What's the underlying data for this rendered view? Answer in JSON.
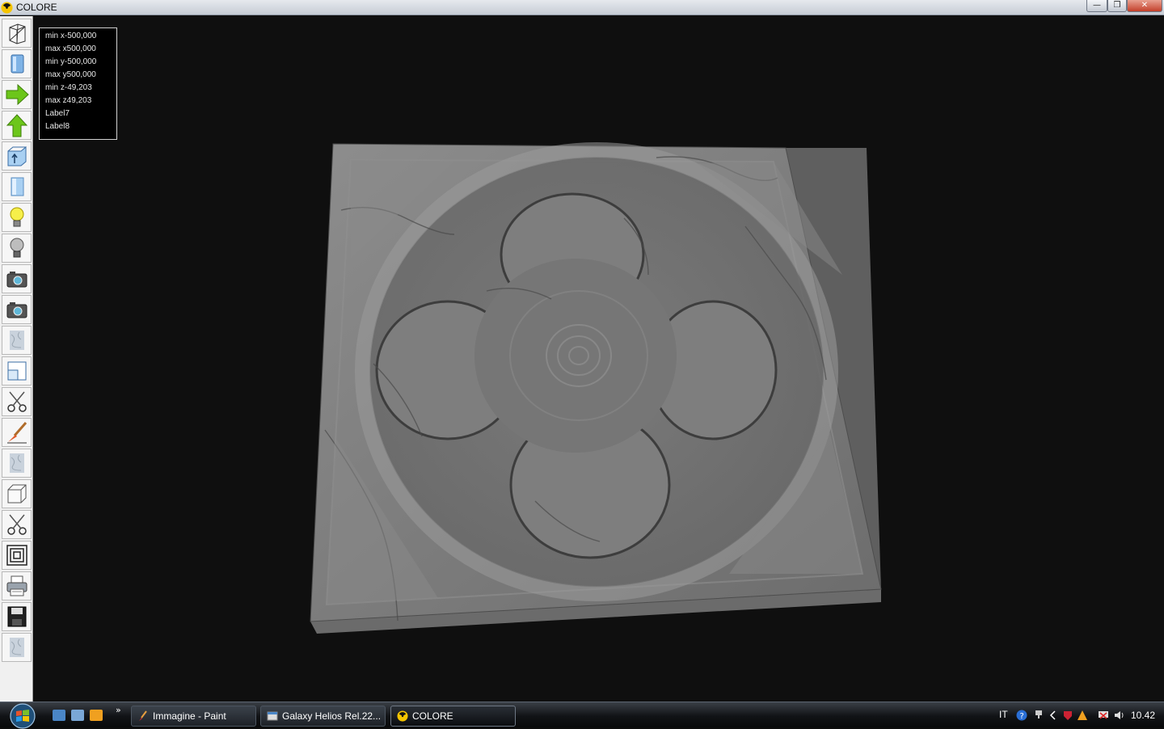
{
  "window": {
    "title": "COLORE",
    "controls": {
      "minimize": "—",
      "maximize": "❒",
      "close": "✕"
    }
  },
  "toolbar": {
    "tools": [
      {
        "name": "wireframe-tool",
        "icon": "wireframe-box-icon"
      },
      {
        "name": "solid-view-tool",
        "icon": "blue-cylinder-icon"
      },
      {
        "name": "arrow-right-tool",
        "icon": "green-arrow-right-icon"
      },
      {
        "name": "arrow-up-tool",
        "icon": "green-arrow-up-icon"
      },
      {
        "name": "extrude-tool",
        "icon": "blue-cube-arrow-icon"
      },
      {
        "name": "cylinder-tool",
        "icon": "light-blue-cylinder-icon"
      },
      {
        "name": "light-on-tool",
        "icon": "yellow-bulb-icon"
      },
      {
        "name": "light-off-tool",
        "icon": "gray-bulb-icon"
      },
      {
        "name": "camera-tool",
        "icon": "camera-icon"
      },
      {
        "name": "camera-2-tool",
        "icon": "camera-icon"
      },
      {
        "name": "texture-tool",
        "icon": "marble-texture-icon"
      },
      {
        "name": "window-tool",
        "icon": "window-square-icon"
      },
      {
        "name": "cut-tool",
        "icon": "scissors-icon"
      },
      {
        "name": "brush-tool",
        "icon": "paint-brush-icon"
      },
      {
        "name": "texture-2-tool",
        "icon": "marble-texture-icon"
      },
      {
        "name": "box-tool",
        "icon": "white-box-icon"
      },
      {
        "name": "cut-2-tool",
        "icon": "scissors-icon"
      },
      {
        "name": "frame-tool",
        "icon": "concentric-squares-icon"
      },
      {
        "name": "print-tool",
        "icon": "printer-icon"
      },
      {
        "name": "save-tool",
        "icon": "floppy-disk-icon"
      },
      {
        "name": "texture-3-tool",
        "icon": "marble-texture-icon"
      }
    ]
  },
  "info": {
    "min_x": "min x-500,000",
    "max_x": "max x500,000",
    "min_y": "min y-500,000",
    "max_y": "max y500,000",
    "min_z": "min z-49,203",
    "max_z": "max z49,203",
    "label7": "Label7",
    "label8": "Label8"
  },
  "scene": {
    "object": "marble-tile-quatrefoil",
    "background": "#0f0f0f"
  },
  "taskbar": {
    "quicklaunch_chevron": "»",
    "tasks": [
      {
        "label": "Immagine - Paint",
        "active": false
      },
      {
        "label": "Galaxy Helios  Rel.22...",
        "active": false
      },
      {
        "label": "COLORE",
        "active": true
      }
    ],
    "tray": {
      "lang": "IT",
      "time": "10.42"
    }
  }
}
